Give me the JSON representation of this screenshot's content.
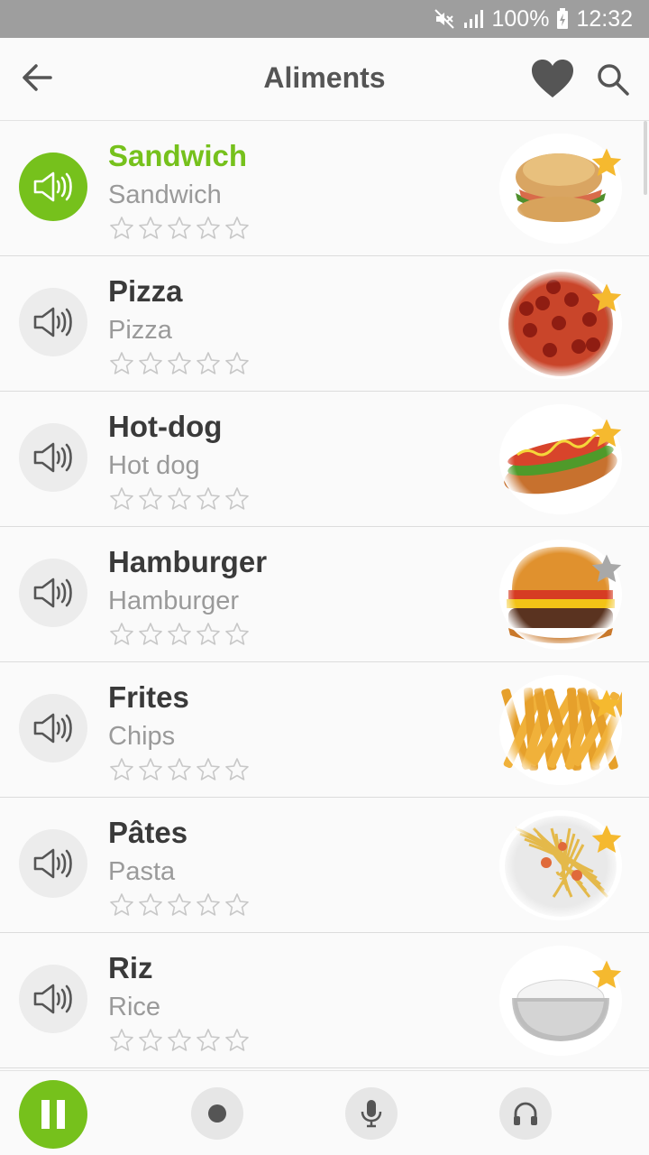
{
  "status": {
    "battery": "100%",
    "time": "12:32"
  },
  "header": {
    "title": "Aliments"
  },
  "colors": {
    "accent": "#76c11c",
    "star_gold": "#f5b92f",
    "star_gray": "#a8a8a8"
  },
  "items": [
    {
      "fr": "Sandwich",
      "en": "Sandwich",
      "active": true,
      "favorite": true,
      "image": "sandwich"
    },
    {
      "fr": "Pizza",
      "en": "Pizza",
      "active": false,
      "favorite": true,
      "image": "pizza"
    },
    {
      "fr": "Hot-dog",
      "en": "Hot dog",
      "active": false,
      "favorite": true,
      "image": "hotdog"
    },
    {
      "fr": "Hamburger",
      "en": "Hamburger",
      "active": false,
      "favorite": false,
      "image": "hamburger"
    },
    {
      "fr": "Frites",
      "en": "Chips",
      "active": false,
      "favorite": true,
      "image": "fries"
    },
    {
      "fr": "Pâtes",
      "en": "Pasta",
      "active": false,
      "favorite": true,
      "image": "pasta"
    },
    {
      "fr": "Riz",
      "en": "Rice",
      "active": false,
      "favorite": true,
      "image": "rice"
    }
  ],
  "rating": {
    "max": 5,
    "value": 0
  },
  "player": {
    "buttons": [
      "pause-icon",
      "record-icon",
      "microphone-icon",
      "headphones-icon"
    ]
  }
}
